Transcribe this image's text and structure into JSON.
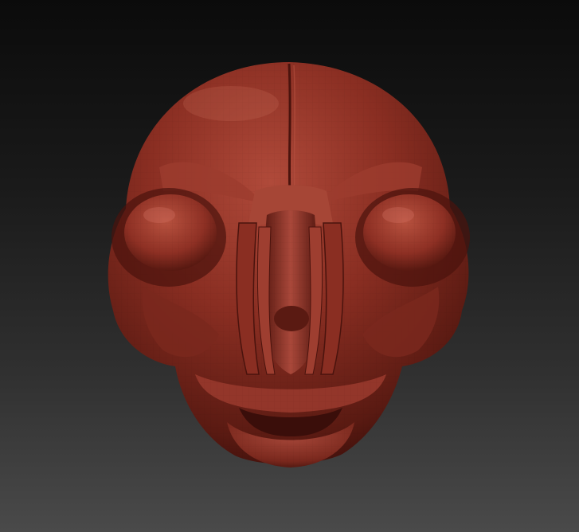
{
  "scene": {
    "subject": "sculpted-head",
    "material_color": "#8a2e22",
    "material_highlight": "#c25a48",
    "material_shadow": "#3a0e0a",
    "background_top": "#0b0b0b",
    "background_bottom": "#4a4a4a"
  }
}
